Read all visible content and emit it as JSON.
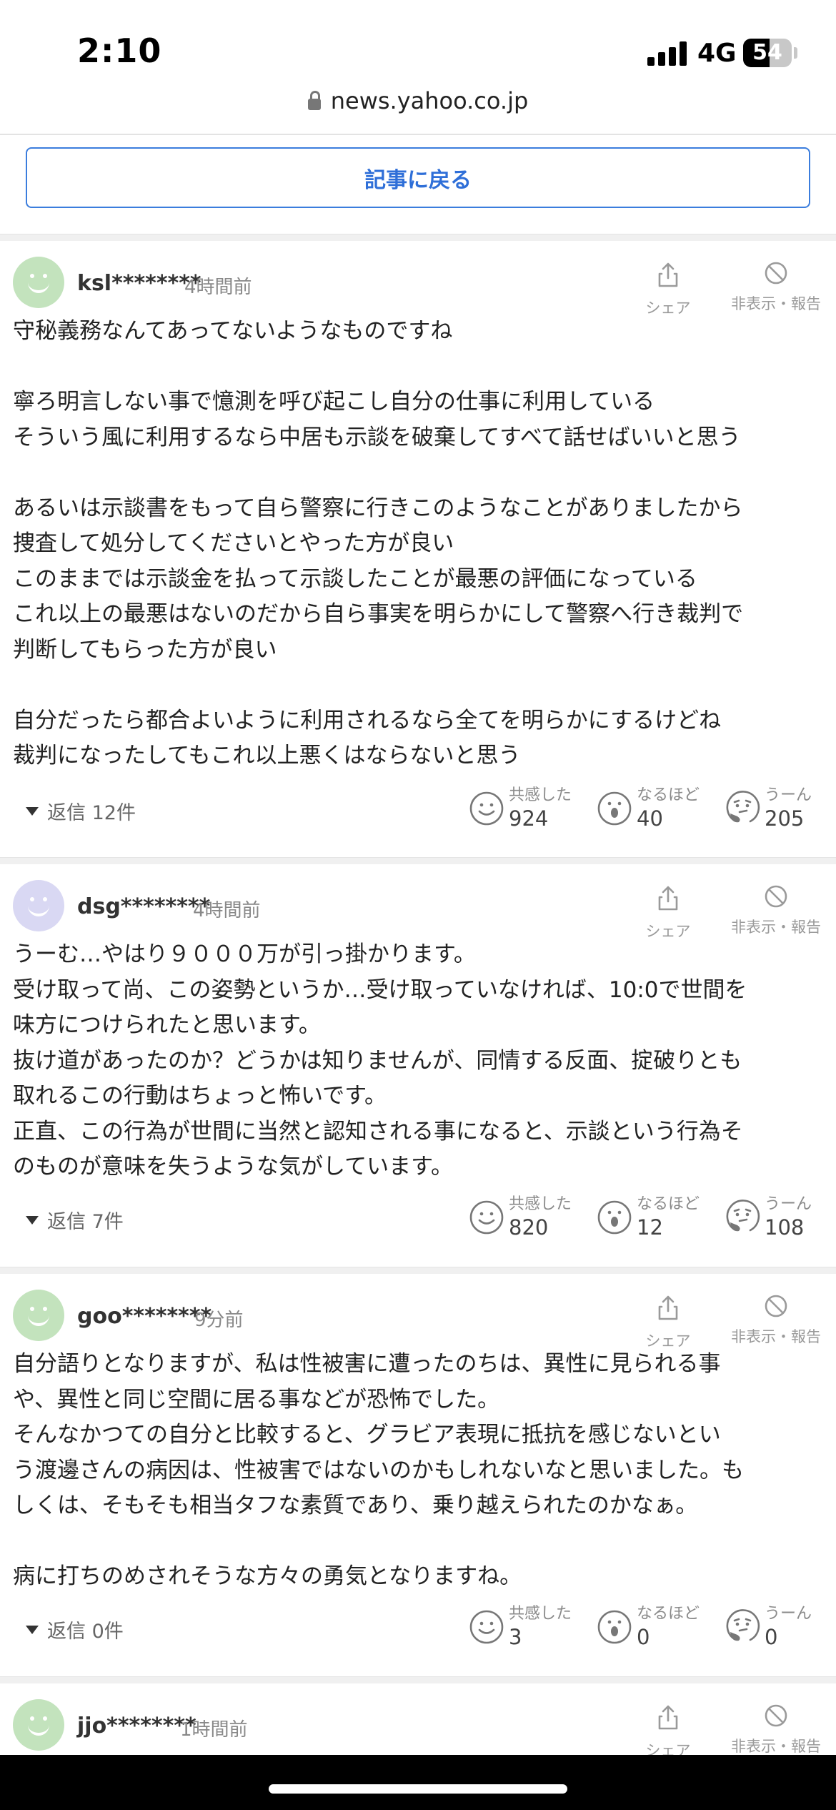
{
  "status_bar": {
    "time": "2:10",
    "network": "4G",
    "battery_text": "54",
    "battery_level": 0.54
  },
  "browser": {
    "url": "news.yahoo.co.jp"
  },
  "back_button_label": "記事に戻る",
  "colors": {
    "accent": "#3b7ddd",
    "avatar_green": "#c3e3bd",
    "avatar_face_green": "#9fd39a",
    "avatar_purple": "#d9d8f3",
    "avatar_face_purple": "#b4b3e6"
  },
  "labels": {
    "share": "シェア",
    "hide_report": "非表示・報告",
    "empathy": "共感した",
    "insight": "なるほど",
    "hmm": "うーん"
  },
  "comments": [
    {
      "user": "ksl********",
      "time": "4時間前",
      "avatar_color": "green",
      "body": "守秘義務なんてあってないようなものですね\n\n寧ろ明言しない事で憶測を呼び起こし自分の仕事に利用している\nそういう風に利用するなら中居も示談を破棄してすべて話せばいいと思う\n\nあるいは示談書をもって自ら警察に行きこのようなことがありましたから\n捜査して処分してくださいとやった方が良い\nこのままでは示談金を払って示談したことが最悪の評価になっている\nこれ以上の最悪はないのだから自ら事実を明らかにして警察へ行き裁判で\n判断してもらった方が良い\n\n自分だったら都合よいように利用されるなら全てを明らかにするけどね\n裁判になったしてもこれ以上悪くはならないと思う",
      "replies": "返信 12件",
      "empathy": "924",
      "insight": "40",
      "hmm": "205"
    },
    {
      "user": "dsg********",
      "time": "4時間前",
      "avatar_color": "purple",
      "body": "うーむ…やはり９０００万が引っ掛かります。\n受け取って尚、この姿勢というか…受け取っていなければ、10:0で世間を\n味方につけられたと思います。\n抜け道があったのか？どうかは知りませんが、同情する反面、掟破りとも\n取れるこの行動はちょっと怖いです。\n正直、この行為が世間に当然と認知される事になると、示談という行為そ\nのものが意味を失うような気がしています。",
      "replies": "返信 7件",
      "empathy": "820",
      "insight": "12",
      "hmm": "108"
    },
    {
      "user": "goo********",
      "time": "9分前",
      "avatar_color": "green",
      "body": "自分語りとなりますが、私は性被害に遭ったのちは、異性に見られる事\nや、異性と同じ空間に居る事などが恐怖でした。\nそんなかつての自分と比較すると、グラビア表現に抵抗を感じないとい\nう渡邊さんの病因は、性被害ではないのかもしれないなと思いました。も\nしくは、そもそも相当タフな素質であり、乗り越えられたのかなぁ。\n\n病に打ちのめされそうな方々の勇気となりますね。",
      "replies": "返信 0件",
      "empathy": "3",
      "insight": "0",
      "hmm": "0"
    },
    {
      "user": "jjo********",
      "time": "1時間前",
      "avatar_color": "green"
    }
  ]
}
